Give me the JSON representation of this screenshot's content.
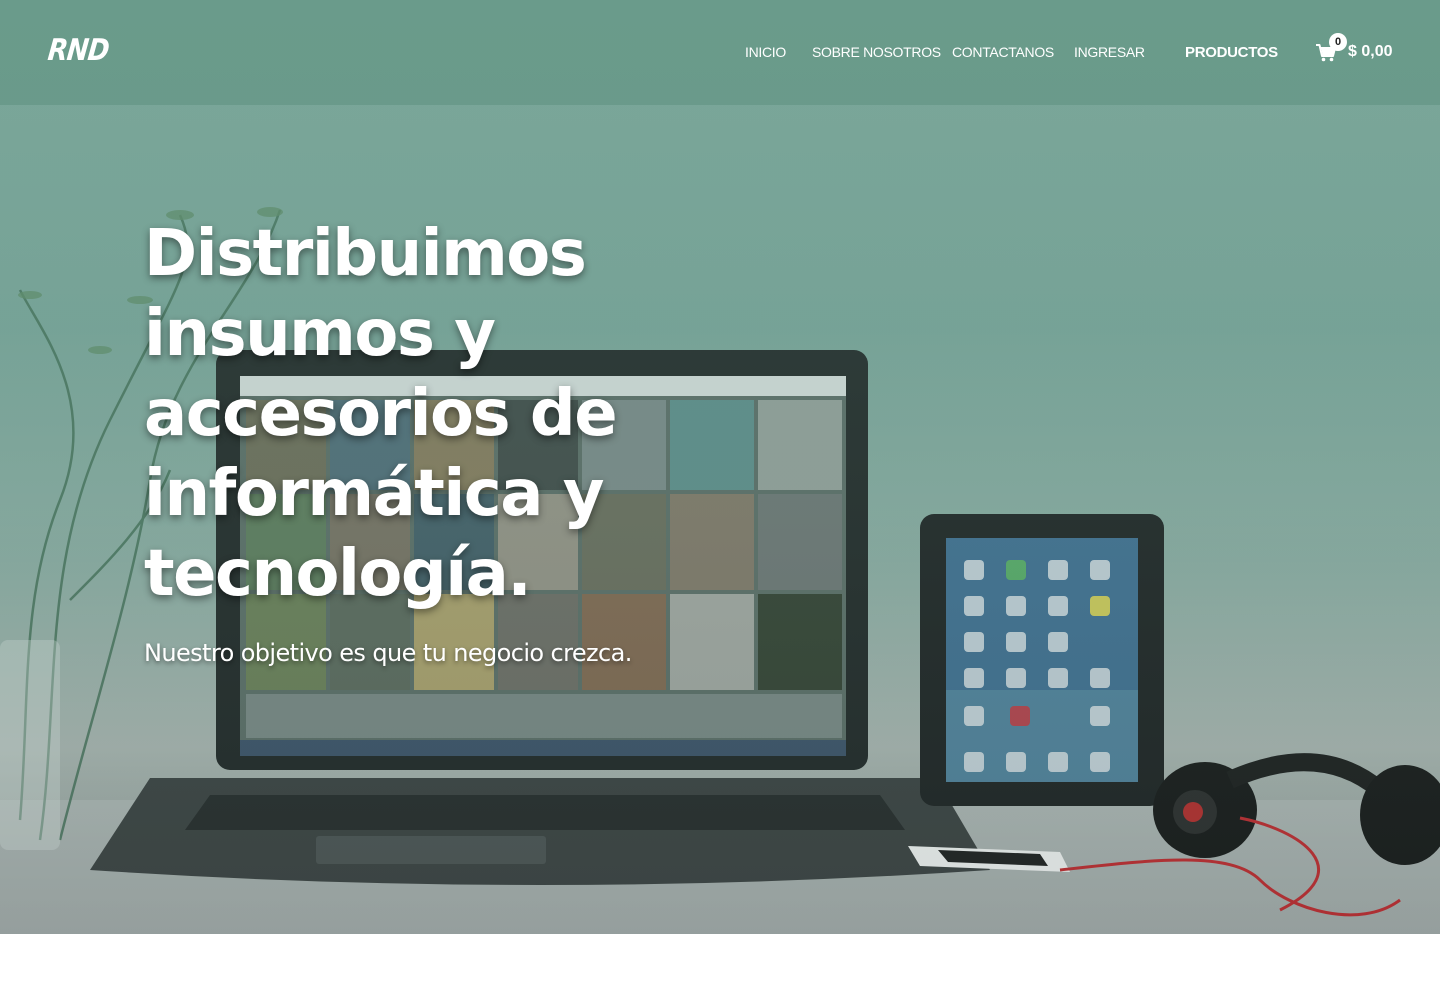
{
  "header": {
    "logo": "RND",
    "nav": [
      {
        "label": "INICIO"
      },
      {
        "label": "SOBRE NOSOTROS"
      },
      {
        "label": "CONTACTANOS"
      },
      {
        "label": "INGRESAR"
      },
      {
        "label": "PRODUCTOS"
      }
    ],
    "cart": {
      "icon": "shopping-cart-icon",
      "count": "0",
      "total": "$ 0,00"
    }
  },
  "hero": {
    "title": "Distribuimos insumos y accesorios de informática y tecnología.",
    "subtitle": "Nuestro objetivo es que tu negocio crezca.",
    "background_image": "laptop, tablet and headphones on a white desk with a plant",
    "accent_color": "#7aa89b"
  }
}
